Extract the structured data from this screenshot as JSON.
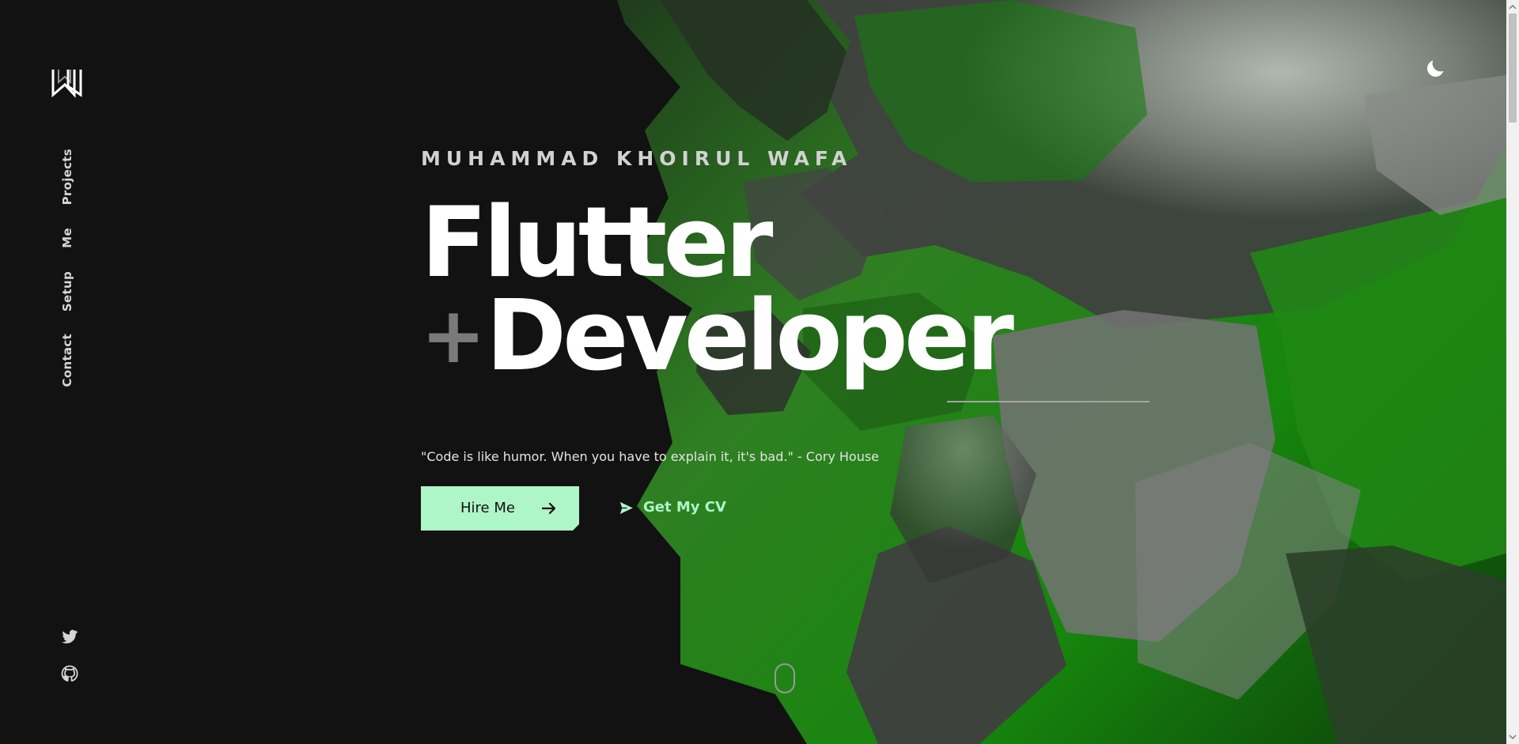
{
  "brand": {
    "logo": "monogram-w-logo"
  },
  "sidebar": {
    "nav_items": [
      "Projects",
      "Me",
      "Setup",
      "Contact"
    ],
    "social_icons": [
      "twitter-icon",
      "github-icon"
    ]
  },
  "header": {
    "theme_icon": "moon-icon"
  },
  "hero": {
    "name": "MUHAMMAD KHOIRUL WAFA",
    "headline_line_1": "Flutter",
    "headline_plus": "+",
    "headline_line_2": "Developer",
    "quote": "\"Code is like humor. When you have to explain it, it's bad.\" - Cory House",
    "hire_button": "Hire Me",
    "cv_link": "Get My CV"
  },
  "colors": {
    "background": "#121212",
    "accent": "#aef5c8",
    "green_art": "#1c8a12",
    "gray_art": "#7b7b7b"
  }
}
